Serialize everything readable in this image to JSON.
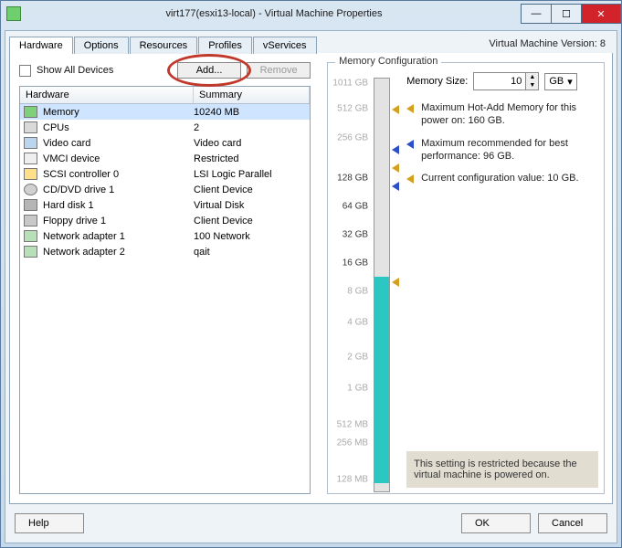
{
  "window": {
    "title": "virt177(esxi13-local) - Virtual Machine Properties"
  },
  "tabs": {
    "hardware": "Hardware",
    "options": "Options",
    "resources": "Resources",
    "profiles": "Profiles",
    "vservices": "vServices",
    "version": "Virtual Machine Version: 8"
  },
  "left": {
    "show_all": "Show All Devices",
    "add": "Add...",
    "remove": "Remove",
    "col_hardware": "Hardware",
    "col_summary": "Summary"
  },
  "rows": [
    {
      "name": "Memory",
      "summary": "10240 MB",
      "icon": "mem",
      "selected": true
    },
    {
      "name": "CPUs",
      "summary": "2",
      "icon": "cpu"
    },
    {
      "name": "Video card",
      "summary": "Video card",
      "icon": "video"
    },
    {
      "name": "VMCI device",
      "summary": "Restricted",
      "icon": "vmci"
    },
    {
      "name": "SCSI controller 0",
      "summary": "LSI Logic Parallel",
      "icon": "scsi"
    },
    {
      "name": "CD/DVD drive 1",
      "summary": "Client Device",
      "icon": "cd"
    },
    {
      "name": "Hard disk 1",
      "summary": "Virtual Disk",
      "icon": "hd"
    },
    {
      "name": "Floppy drive 1",
      "summary": "Client Device",
      "icon": "floppy"
    },
    {
      "name": "Network adapter 1",
      "summary": "100 Network",
      "icon": "net"
    },
    {
      "name": "Network adapter 2",
      "summary": "qait",
      "icon": "net"
    }
  ],
  "mem": {
    "legend": "Memory Configuration",
    "size_label": "Memory Size:",
    "size_value": "10",
    "unit": "GB",
    "note_max": "Maximum Hot-Add Memory for this power on: 160 GB.",
    "note_best": "Maximum recommended for best performance: 96 GB.",
    "note_current": "Current configuration value: 10 GB.",
    "warn": "This setting is restricted because the virtual machine is powered on."
  },
  "scale": {
    "t1011": "1011 GB",
    "t512u": "512 GB",
    "t256": "256 GB",
    "t128": "128 GB",
    "t64": "64 GB",
    "t32": "32 GB",
    "t16": "16 GB",
    "t8": "8 GB",
    "t4": "4 GB",
    "t2": "2 GB",
    "t1": "1 GB",
    "t512l": "512 MB",
    "t256l": "256 MB",
    "t128l": "128 MB"
  },
  "footer": {
    "help": "Help",
    "ok": "OK",
    "cancel": "Cancel"
  }
}
